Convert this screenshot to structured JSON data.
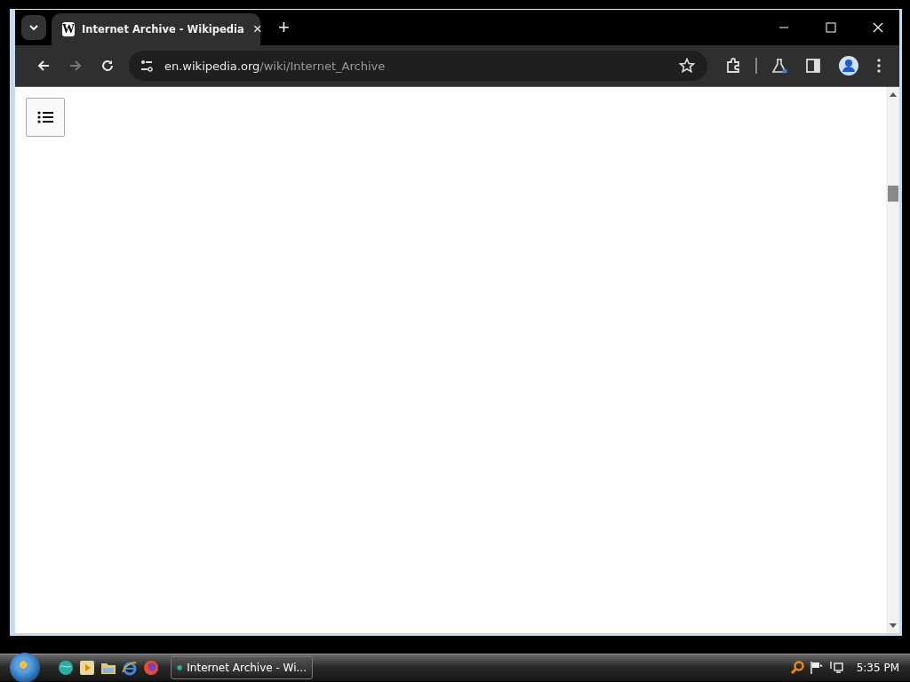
{
  "browser": {
    "tab": {
      "favicon": "W",
      "title": "Internet Archive - Wikipedia",
      "close": "×",
      "selected": true
    },
    "new_tab": "+",
    "address": {
      "host": "en.wikipedia.org",
      "path": "/wiki/Internet_Archive"
    }
  },
  "taskbar": {
    "tasks": [
      {
        "label": "Internet Archive - Wi...",
        "selected": true
      }
    ],
    "clock": "5:35 PM"
  }
}
